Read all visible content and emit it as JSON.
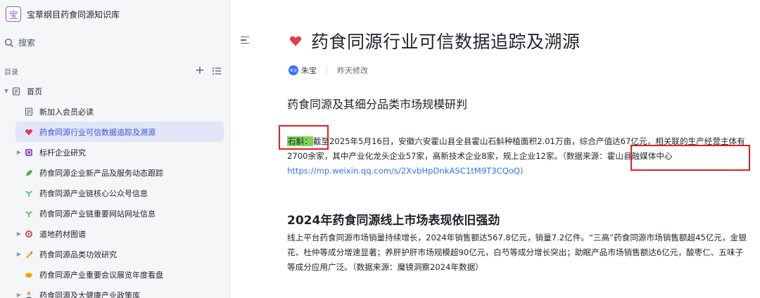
{
  "sidebar": {
    "brand_logo": "宝",
    "brand_title": "宝草纲目药食同源知识库",
    "search_label": "搜索",
    "toc_label": "目录",
    "items": [
      {
        "label": "首页",
        "icon": "doc-icon",
        "level": 0,
        "expanded": true
      },
      {
        "label": "新加入会员必读",
        "icon": "doc-icon",
        "level": 1
      },
      {
        "label": "药食同源行业可信数据追踪及溯源",
        "icon": "heart-icon",
        "level": 1,
        "active": true
      },
      {
        "label": "标杆企业研究",
        "icon": "purple-box-icon",
        "level": 1,
        "collapsed": true
      },
      {
        "label": "药食同源企业新产品及服务动态跟踪",
        "icon": "leaf-icon",
        "level": 1
      },
      {
        "label": "药食同源产业链核心公众号信息",
        "icon": "sprout-icon",
        "level": 1
      },
      {
        "label": "药食同源产业链重要网站网址信息",
        "icon": "sprout-icon",
        "level": 1
      },
      {
        "label": "道地药材图谱",
        "icon": "target-icon",
        "level": 1,
        "collapsed": true
      },
      {
        "label": "药食同源品类功效研究",
        "icon": "crayon-icon",
        "level": 1,
        "collapsed": true
      },
      {
        "label": "药食同源产业重要会议展览年度看盘",
        "icon": "handshake-icon",
        "level": 1
      },
      {
        "label": "药食同源及大健康产业政策库",
        "icon": "person-icon",
        "level": 1,
        "collapsed": true
      }
    ]
  },
  "doc": {
    "title": "药食同源行业可信数据追踪及溯源",
    "author_avatar": "朱宝",
    "author": "朱宝",
    "modified": "昨天修改",
    "section1_title": "药食同源及其细分品类市场规模研判",
    "section1_highlight": "石斛：",
    "section1_text": "截至2025年5月16日，安徽六安霍山县全县霍山石斛种植面积2.01万亩，综合产值达67亿元，相关联的生产经营主体有2700余家，其中产业化龙头企业57家，高新技术企业8家，规上企业12家。（数据来源：霍山县融媒体中心 ",
    "section1_link": "https://mp.weixin.qq.com/s/2XvbHpDnkASC1tM9T3CQoQ)",
    "section2_title": "2024年药食同源线上市场表现依旧强劲",
    "section2_text": "线上平台药食同源市场销量持续增长，2024年销售额达567.8亿元，销量7.2亿件。“三高”药食同源市场销售额超45亿元，金银花、杜仲等成分增速显著；养肝护肝市场规模超90亿元，白芍等成分增长突出；助眠产品市场销售额达6亿元，酸枣仁、五味子等成分应用广泛。（数据来源：魔镜洞察2024年数据）"
  },
  "colors": {
    "accent": "#3370ff",
    "active_bg": "#e1e5f8",
    "highlight": "#7fd35b",
    "annotation_red": "#e02020"
  }
}
